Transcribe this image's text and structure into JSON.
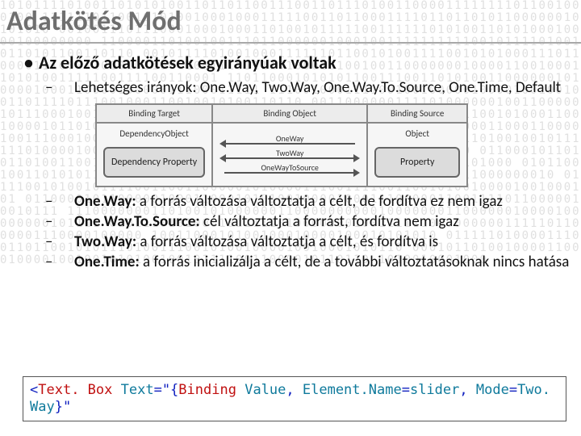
{
  "title": "Adatkötés Mód",
  "bullets": {
    "main": "Az előző adatkötések egyirányúak voltak",
    "modes": "Lehetséges irányok: One.Way, Two.Way, One.Way.To.Source, One.Time, Default",
    "ow_b": "One.Way:",
    "ow_t": " a forrás változása változtatja a célt, de fordítva ez nem igaz",
    "ows_b": "One.Way.To.Source:",
    "ows_t": " cél változtatja a forrást, fordítva nem igaz",
    "tw_b": "Two.Way:",
    "tw_t": " a forrás változása változtatja a célt, és fordítva is",
    "ot_b": "One.Time:",
    "ot_t": " a forrás inicializálja a célt, de a további változtatásoknak nincs hatása"
  },
  "diagram": {
    "head_target": "Binding Target",
    "head_obj": "Binding Object",
    "head_source": "Binding Source",
    "left_top": "DependencyObject",
    "left_box": "Dependency Property",
    "right_top": "Object",
    "right_box": "Property",
    "m1": "OneWay",
    "m2": "TwoWay",
    "m3": "OneWayToSource"
  },
  "code": {
    "open": "<",
    "tag": "Text. Box",
    "sp1": " ",
    "attr1": "Text",
    "eq": "=\"{",
    "bind": "Binding",
    "sp2": " ",
    "val": "Value",
    "c1": ", ",
    "en_k": "Element.Name",
    "en_eq": "=",
    "en_v": "slider",
    "c2": ", ",
    "mode_k": "Mode",
    "mode_eq": "=",
    "mode_v": "Two. Way",
    "close": "}\""
  },
  "bg": "1010111101001101010100110110110011100110111010011000011111111011001000100 1111110110010101001000100011111001101100011110110110101100000010101010 0010011101110001000100011010010111110011111101010011010100010000100000000 1100001101001001110110000001000100111111111100101111010010110101100110110 0010111101001000111111011001010011110010101000111011000011100011010101100 1001110111101000101001001100000001000011001000110101001111100111100110001 1101100010101011001110011010100110000001010000100011000010000011100011111 1110010001111001001000001000010010010011011110111001000110010010100110110 0011000000111101000000100110000010111000100101111001001010110001001101110 1001100100010110010100011001000010110100001011000010101100101010110011010 0000001000011000110000100111000100111010000001111100001011010010101010110 1111101001001011111101000010001001001000001000010100100010000110010101010 0110001011010110100110011000001000010010001101001111100011000111001101000 0101100100110101011001000100101101000010110011110110111100101011000000010 0111100101001011110011001100000101000011100111100110010100100001001000101 0110000101100000100011000101010010000100011100000110011110110000010010111 1110000000110100101000000110000000000100000001100000010000100000000101111 0101110101000101111101000000010011111100000000011111011000001110000100000 1001100010100100010000100010101010 0111110100001110011011001010111010011100101001000010010001010110 0001011010010000110001000010010010101001001011110011000010110110 1010010001000"
}
